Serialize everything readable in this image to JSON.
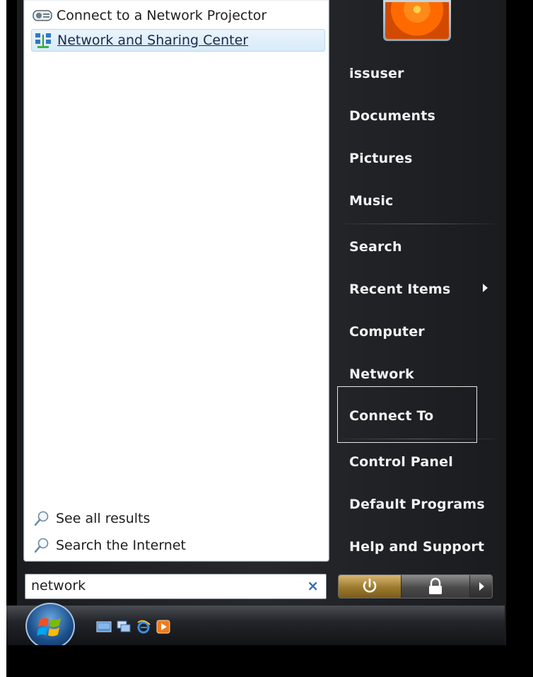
{
  "results": {
    "projector": {
      "label": "Connect to a Network Projector",
      "icon": "projector-icon"
    },
    "network_center": {
      "label": "Network and Sharing Center",
      "icon": "network-icon"
    },
    "see_all": {
      "label": "See all results",
      "icon": "search-magnifier-icon"
    },
    "search_internet": {
      "label": "Search the Internet",
      "icon": "search-magnifier-icon"
    }
  },
  "search": {
    "value": "network",
    "clear_icon": "×"
  },
  "right_pane": {
    "items": [
      {
        "label": "issuser"
      },
      {
        "label": "Documents"
      },
      {
        "label": "Pictures"
      },
      {
        "label": "Music"
      },
      {
        "label": "Search"
      },
      {
        "label": "Recent Items"
      },
      {
        "label": "Computer"
      },
      {
        "label": "Network"
      },
      {
        "label": "Connect To"
      },
      {
        "label": "Control Panel"
      },
      {
        "label": "Default Programs"
      },
      {
        "label": "Help and Support"
      }
    ]
  },
  "colors": {
    "accent_highlight": "#d9ebfa",
    "menu_bg": "#26282c",
    "power_button": "#9c7a2c"
  }
}
